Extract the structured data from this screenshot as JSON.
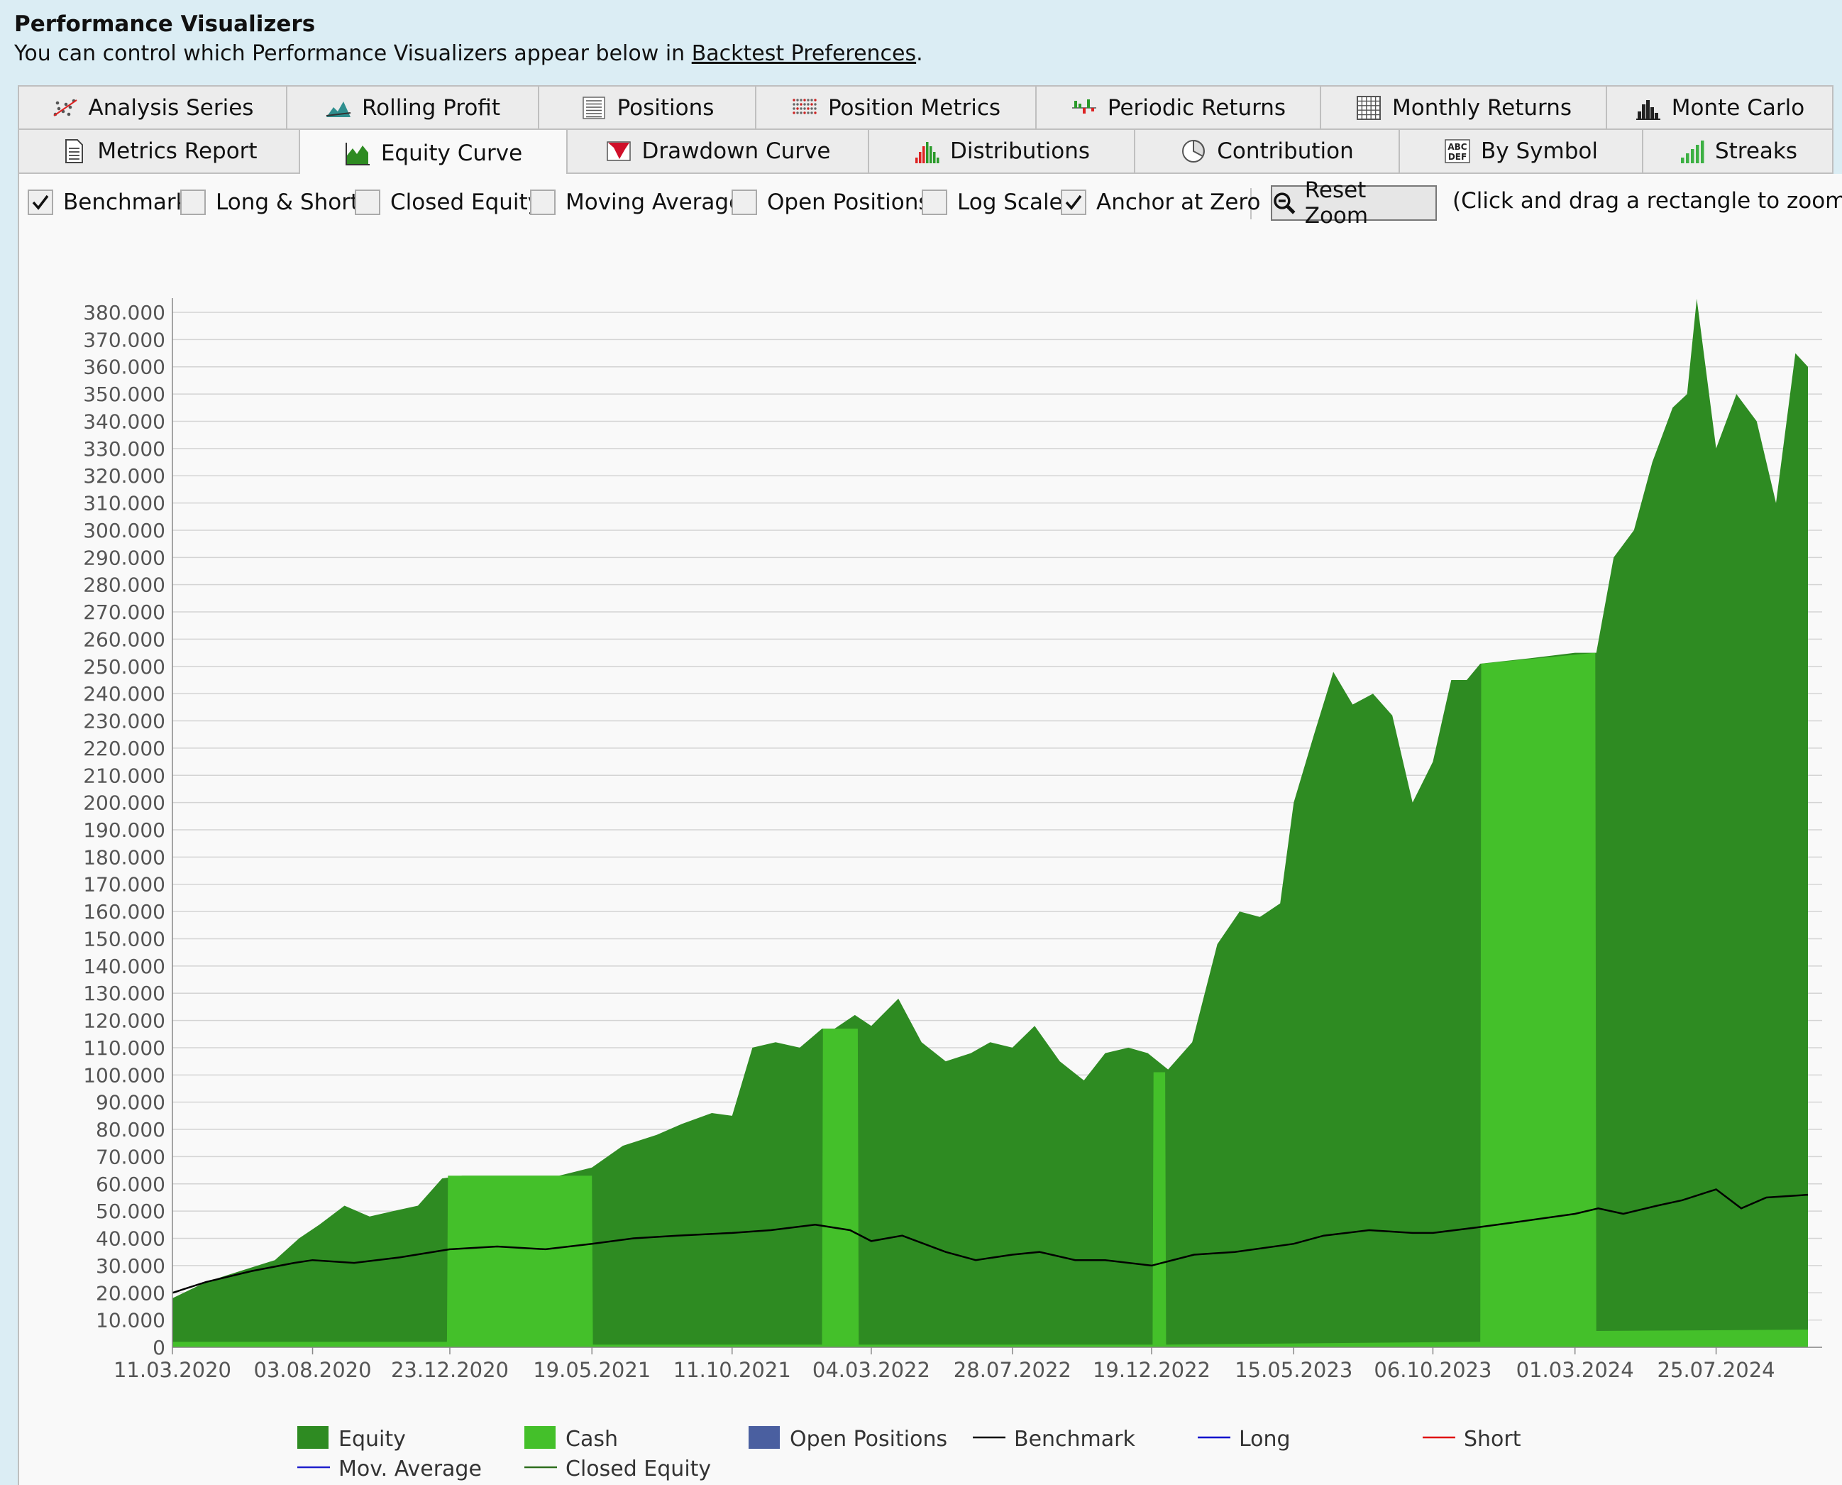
{
  "header": {
    "title": "Performance Visualizers",
    "subtitle_prefix": "You can control which Performance Visualizers appear below in ",
    "subtitle_link": "Backtest Preferences",
    "subtitle_suffix": "."
  },
  "tabs_row1": [
    {
      "label": "Analysis Series",
      "icon": "scatter-icon"
    },
    {
      "label": "Rolling Profit",
      "icon": "mountain-icon"
    },
    {
      "label": "Positions",
      "icon": "list-icon"
    },
    {
      "label": "Position Metrics",
      "icon": "dots-icon"
    },
    {
      "label": "Periodic Returns",
      "icon": "bars-icon"
    },
    {
      "label": "Monthly Returns",
      "icon": "grid-icon"
    },
    {
      "label": "Monte Carlo",
      "icon": "histogram-icon"
    }
  ],
  "tabs_row2": [
    {
      "label": "Metrics Report",
      "icon": "document-icon"
    },
    {
      "label": "Equity Curve",
      "icon": "area-chart-icon"
    },
    {
      "label": "Drawdown Curve",
      "icon": "drawdown-icon"
    },
    {
      "label": "Distributions",
      "icon": "distribution-icon"
    },
    {
      "label": "Contribution",
      "icon": "pie-icon"
    },
    {
      "label": "By Symbol",
      "icon": "abc-icon"
    },
    {
      "label": "Streaks",
      "icon": "streaks-icon"
    }
  ],
  "active_tab": "Equity Curve",
  "toolbar": {
    "checkboxes": [
      {
        "label": "Benchmark",
        "checked": true
      },
      {
        "label": "Long & Short",
        "checked": false
      },
      {
        "label": "Closed Equity",
        "checked": false
      },
      {
        "label": "Moving Average",
        "checked": false
      },
      {
        "label": "Open Positions",
        "checked": false
      },
      {
        "label": "Log Scale",
        "checked": false
      },
      {
        "label": "Anchor at Zero",
        "checked": true
      }
    ],
    "reset_zoom_label": "Reset Zoom",
    "hint": "(Click and drag a rectangle to zoom in)"
  },
  "colors": {
    "equity": "#2e8b22",
    "cash": "#44c02a",
    "open_positions": "#4a5fa0",
    "benchmark": "#000000",
    "long": "#0000cc",
    "short": "#e01010",
    "mov_average": "#2020cc",
    "closed_equity": "#2e6e1e"
  },
  "chart_data": {
    "type": "area",
    "title": "",
    "xlabel": "",
    "ylabel": "",
    "ylim": [
      0,
      380000
    ],
    "y_ticks": [
      "0",
      "10.000",
      "20.000",
      "30.000",
      "40.000",
      "50.000",
      "60.000",
      "70.000",
      "80.000",
      "90.000",
      "100.000",
      "110.000",
      "120.000",
      "130.000",
      "140.000",
      "150.000",
      "160.000",
      "170.000",
      "180.000",
      "190.000",
      "200.000",
      "210.000",
      "220.000",
      "230.000",
      "240.000",
      "250.000",
      "260.000",
      "270.000",
      "280.000",
      "290.000",
      "300.000",
      "310.000",
      "320.000",
      "330.000",
      "340.000",
      "350.000",
      "360.000",
      "370.000",
      "380.000"
    ],
    "x_ticks": [
      "11.03.2020",
      "03.08.2020",
      "23.12.2020",
      "19.05.2021",
      "11.10.2021",
      "04.03.2022",
      "28.07.2022",
      "19.12.2022",
      "15.05.2023",
      "06.10.2023",
      "01.03.2024",
      "25.07.2024"
    ],
    "xlim": [
      "2020-03-11",
      "2024-10-28"
    ],
    "grid": true,
    "legend_position": "bottom",
    "legend": [
      {
        "label": "Equity",
        "kind": "box",
        "color_key": "equity"
      },
      {
        "label": "Cash",
        "kind": "box",
        "color_key": "cash"
      },
      {
        "label": "Open Positions",
        "kind": "box",
        "color_key": "open_positions"
      },
      {
        "label": "Benchmark",
        "kind": "line",
        "color_key": "benchmark"
      },
      {
        "label": "Long",
        "kind": "line",
        "color_key": "long"
      },
      {
        "label": "Short",
        "kind": "line",
        "color_key": "short"
      },
      {
        "label": "Mov. Average",
        "kind": "line",
        "color_key": "mov_average"
      },
      {
        "label": "Closed Equity",
        "kind": "line",
        "color_key": "closed_equity"
      }
    ],
    "series": [
      {
        "name": "Equity",
        "x": [
          "2020-03-11",
          "2020-04-15",
          "2020-05-20",
          "2020-06-25",
          "2020-07-20",
          "2020-08-10",
          "2020-09-05",
          "2020-10-01",
          "2020-10-25",
          "2020-11-20",
          "2020-12-15",
          "2021-01-05",
          "2021-02-20",
          "2021-04-15",
          "2021-05-19",
          "2021-06-20",
          "2021-07-25",
          "2021-08-20",
          "2021-09-20",
          "2021-10-11",
          "2021-11-01",
          "2021-11-25",
          "2021-12-20",
          "2022-01-12",
          "2022-01-25",
          "2022-02-15",
          "2022-03-04",
          "2022-04-01",
          "2022-04-25",
          "2022-05-20",
          "2022-06-15",
          "2022-07-05",
          "2022-07-28",
          "2022-08-20",
          "2022-09-15",
          "2022-10-10",
          "2022-11-01",
          "2022-11-25",
          "2022-12-15",
          "2023-01-05",
          "2023-01-30",
          "2023-02-25",
          "2023-03-20",
          "2023-04-10",
          "2023-05-01",
          "2023-05-15",
          "2023-06-05",
          "2023-06-25",
          "2023-07-15",
          "2023-08-05",
          "2023-08-25",
          "2023-09-15",
          "2023-10-06",
          "2023-10-25",
          "2023-11-10",
          "2023-11-24",
          "2024-01-15",
          "2024-03-01",
          "2024-03-23",
          "2024-04-10",
          "2024-05-01",
          "2024-05-20",
          "2024-06-10",
          "2024-06-25",
          "2024-07-05",
          "2024-07-25",
          "2024-08-15",
          "2024-09-05",
          "2024-09-25",
          "2024-10-15",
          "2024-10-28"
        ],
        "values": [
          18000,
          24000,
          28000,
          32000,
          40000,
          45000,
          52000,
          48000,
          50000,
          52000,
          62000,
          63000,
          63000,
          63000,
          66000,
          74000,
          78000,
          82000,
          86000,
          85000,
          110000,
          112000,
          110000,
          117000,
          117000,
          122000,
          118000,
          128000,
          112000,
          105000,
          108000,
          112000,
          110000,
          118000,
          105000,
          98000,
          108000,
          110000,
          108000,
          102000,
          112000,
          148000,
          160000,
          158000,
          163000,
          200000,
          225000,
          248000,
          236000,
          240000,
          232000,
          200000,
          215000,
          245000,
          245000,
          251000,
          253000,
          255000,
          255000,
          290000,
          300000,
          325000,
          345000,
          350000,
          385000,
          330000,
          350000,
          340000,
          310000,
          365000,
          360000
        ]
      },
      {
        "name": "Cash",
        "x": [
          "2020-03-11",
          "2020-12-20",
          "2020-12-21",
          "2021-05-19",
          "2021-05-20",
          "2022-01-12",
          "2022-01-13",
          "2022-02-18",
          "2022-02-19",
          "2022-12-20",
          "2022-12-21",
          "2023-01-02",
          "2023-01-03",
          "2023-11-24",
          "2023-11-25",
          "2024-03-22",
          "2024-03-23",
          "2024-10-28"
        ],
        "values": [
          2000,
          2000,
          63000,
          63000,
          1000,
          1000,
          117000,
          117000,
          1000,
          1000,
          101000,
          101000,
          1000,
          2000,
          251000,
          255000,
          6000,
          6500
        ]
      },
      {
        "name": "Benchmark",
        "x": [
          "2020-03-11",
          "2020-04-15",
          "2020-06-01",
          "2020-07-15",
          "2020-08-03",
          "2020-09-15",
          "2020-11-01",
          "2020-12-23",
          "2021-02-10",
          "2021-04-01",
          "2021-05-19",
          "2021-07-01",
          "2021-08-15",
          "2021-10-11",
          "2021-11-20",
          "2022-01-05",
          "2022-02-10",
          "2022-03-04",
          "2022-04-05",
          "2022-05-20",
          "2022-06-20",
          "2022-07-28",
          "2022-08-25",
          "2022-10-01",
          "2022-11-01",
          "2022-12-19",
          "2023-02-01",
          "2023-03-15",
          "2023-05-15",
          "2023-06-15",
          "2023-08-01",
          "2023-09-15",
          "2023-10-06",
          "2023-11-20",
          "2024-01-01",
          "2024-03-01",
          "2024-03-25",
          "2024-04-20",
          "2024-05-25",
          "2024-06-20",
          "2024-07-25",
          "2024-08-20",
          "2024-09-15",
          "2024-10-28"
        ],
        "values": [
          20000,
          24000,
          28000,
          31000,
          32000,
          31000,
          33000,
          36000,
          37000,
          36000,
          38000,
          40000,
          41000,
          42000,
          43000,
          45000,
          43000,
          39000,
          41000,
          35000,
          32000,
          34000,
          35000,
          32000,
          32000,
          30000,
          34000,
          35000,
          38000,
          41000,
          43000,
          42000,
          42000,
          44000,
          46000,
          49000,
          51000,
          49000,
          52000,
          54000,
          58000,
          51000,
          55000,
          56000
        ]
      }
    ]
  }
}
